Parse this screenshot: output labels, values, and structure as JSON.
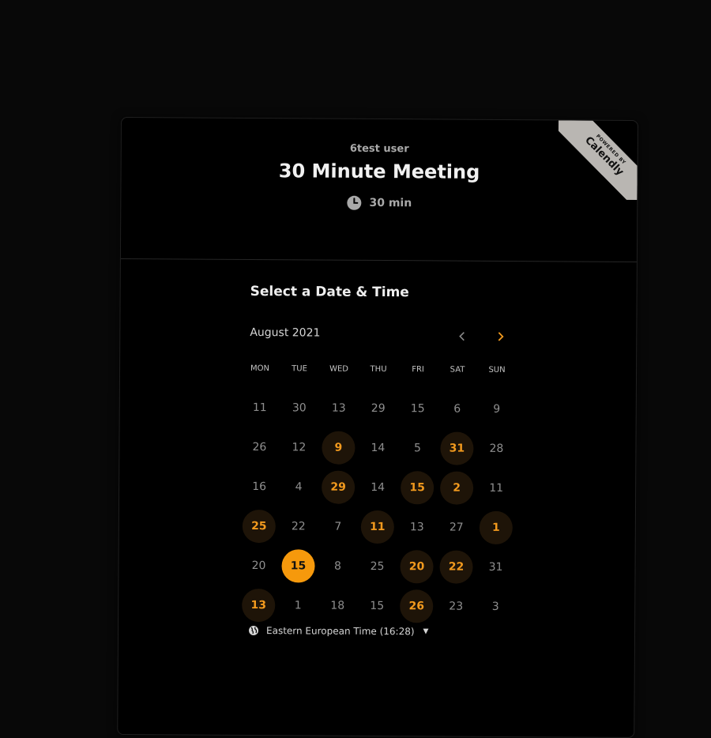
{
  "header": {
    "owner": "6test user",
    "title": "30 Minute Meeting",
    "duration": "30 min"
  },
  "ribbon": {
    "line1": "POWERED BY",
    "line2": "Calendly"
  },
  "calendar": {
    "heading": "Select a Date & Time",
    "month_label": "August 2021",
    "weekdays": [
      "MON",
      "TUE",
      "WED",
      "THU",
      "FRI",
      "SAT",
      "SUN"
    ],
    "weeks": [
      [
        {
          "d": "11",
          "s": "off"
        },
        {
          "d": "30",
          "s": "off"
        },
        {
          "d": "13",
          "s": "off"
        },
        {
          "d": "29",
          "s": "off"
        },
        {
          "d": "15",
          "s": "off"
        },
        {
          "d": "6",
          "s": "off"
        },
        {
          "d": "9",
          "s": "off"
        }
      ],
      [
        {
          "d": "26",
          "s": "off"
        },
        {
          "d": "12",
          "s": "off"
        },
        {
          "d": "9",
          "s": "avail"
        },
        {
          "d": "14",
          "s": "off"
        },
        {
          "d": "5",
          "s": "off"
        },
        {
          "d": "31",
          "s": "avail"
        },
        {
          "d": "28",
          "s": "off"
        }
      ],
      [
        {
          "d": "16",
          "s": "off"
        },
        {
          "d": "4",
          "s": "off"
        },
        {
          "d": "29",
          "s": "avail"
        },
        {
          "d": "14",
          "s": "off"
        },
        {
          "d": "15",
          "s": "avail"
        },
        {
          "d": "2",
          "s": "avail"
        },
        {
          "d": "11",
          "s": "off"
        }
      ],
      [
        {
          "d": "25",
          "s": "avail"
        },
        {
          "d": "22",
          "s": "off"
        },
        {
          "d": "7",
          "s": "off"
        },
        {
          "d": "11",
          "s": "avail"
        },
        {
          "d": "13",
          "s": "off"
        },
        {
          "d": "27",
          "s": "off"
        },
        {
          "d": "1",
          "s": "avail"
        }
      ],
      [
        {
          "d": "20",
          "s": "off"
        },
        {
          "d": "15",
          "s": "selected"
        },
        {
          "d": "8",
          "s": "off"
        },
        {
          "d": "25",
          "s": "off"
        },
        {
          "d": "20",
          "s": "avail"
        },
        {
          "d": "22",
          "s": "avail"
        },
        {
          "d": "31",
          "s": "off"
        }
      ],
      [
        {
          "d": "13",
          "s": "avail"
        },
        {
          "d": "1",
          "s": "off"
        },
        {
          "d": "18",
          "s": "off"
        },
        {
          "d": "15",
          "s": "off"
        },
        {
          "d": "26",
          "s": "avail"
        },
        {
          "d": "23",
          "s": "off"
        },
        {
          "d": "3",
          "s": "off"
        }
      ]
    ]
  },
  "timezone": {
    "label": "Eastern European Time (16:28)"
  },
  "colors": {
    "accent": "#f6990c",
    "available_bg": "#1e1408",
    "background": "#000000"
  },
  "icons": {
    "clock": "clock-icon",
    "prev": "chevron-left-icon",
    "next": "chevron-right-icon",
    "globe": "globe-icon",
    "caret": "caret-down-icon"
  }
}
